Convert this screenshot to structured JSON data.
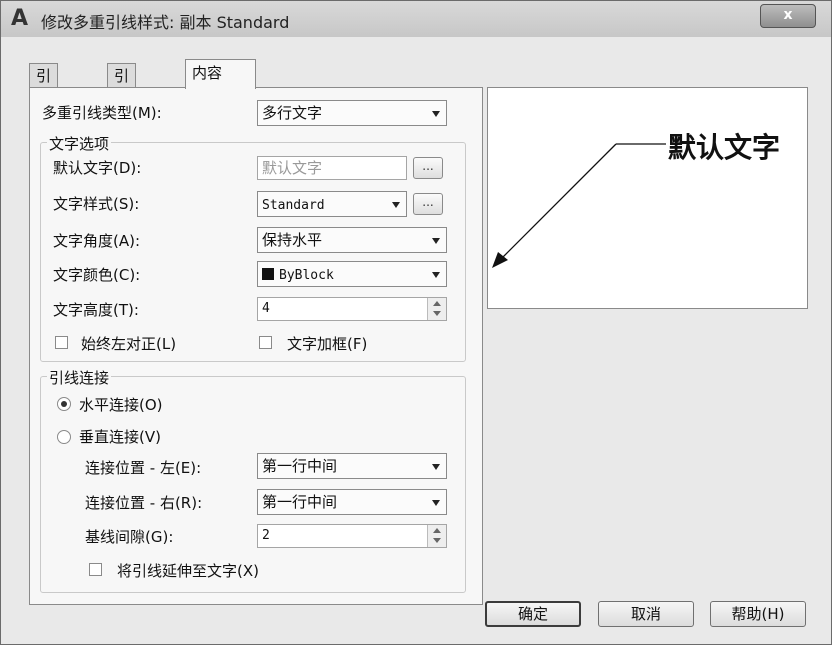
{
  "window": {
    "title": "修改多重引线样式: 副本 Standard",
    "close_label": "x"
  },
  "tabs": [
    {
      "label": "引线格式"
    },
    {
      "label": "引线结构"
    },
    {
      "label": "内容",
      "active": true
    }
  ],
  "content": {
    "leader_type_label": "多重引线类型(M):",
    "leader_type_value": "多行文字",
    "text_options": {
      "title": "文字选项",
      "default_text_label": "默认文字(D):",
      "default_text_value": "默认文字",
      "default_text_button": "...",
      "text_style_label": "文字样式(S):",
      "text_style_value": "Standard",
      "text_style_button": "...",
      "text_angle_label": "文字角度(A):",
      "text_angle_value": "保持水平",
      "text_color_label": "文字颜色(C):",
      "text_color_value": "ByBlock",
      "text_height_label": "文字高度(T):",
      "text_height_value": "4",
      "always_left_label": "始终左对正(L)",
      "always_left_checked": false,
      "frame_text_label": "文字加框(F)",
      "frame_text_checked": false
    },
    "leader_connection": {
      "title": "引线连接",
      "horizontal_label": "水平连接(O)",
      "horizontal_selected": true,
      "vertical_label": "垂直连接(V)",
      "vertical_selected": false,
      "left_attach_label": "连接位置 - 左(E):",
      "left_attach_value": "第一行中间",
      "right_attach_label": "连接位置 - 右(R):",
      "right_attach_value": "第一行中间",
      "landing_gap_label": "基线间隙(G):",
      "landing_gap_value": "2",
      "extend_leader_label": "将引线延伸至文字(X)",
      "extend_leader_checked": false
    }
  },
  "preview": {
    "text": "默认文字"
  },
  "buttons": {
    "ok": "确定",
    "cancel": "取消",
    "help": "帮助(H)"
  }
}
